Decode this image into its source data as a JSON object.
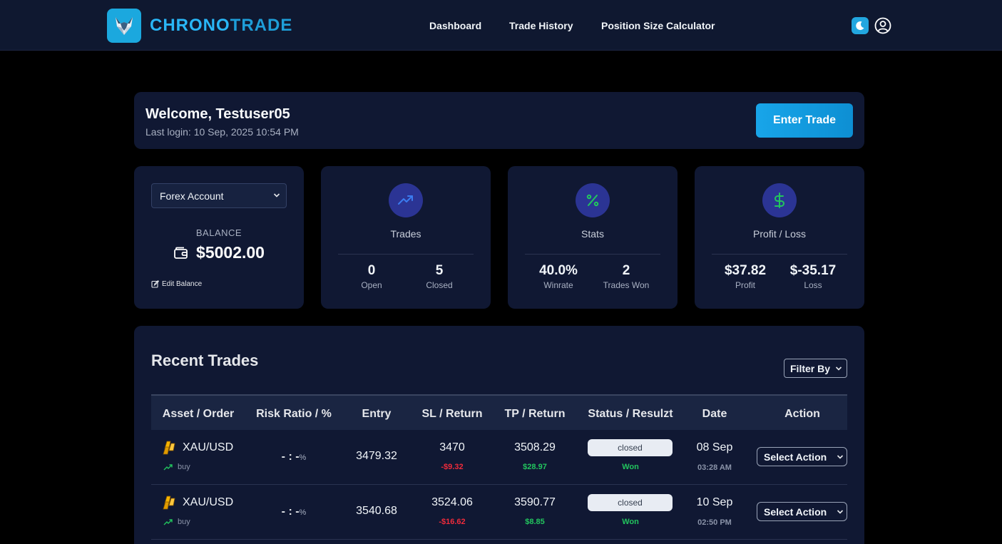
{
  "brand": {
    "part1": "CHRONO",
    "part2": "TRADE"
  },
  "nav": {
    "items": [
      "Dashboard",
      "Trade History",
      "Position Size Calculator"
    ]
  },
  "welcome": {
    "title": "Welcome, Testuser05",
    "last_login": "Last login: 10 Sep, 2025 10:54 PM",
    "enter_trade_label": "Enter Trade"
  },
  "account": {
    "selected": "Forex Account",
    "balance_label": "BALANCE",
    "balance_value": "$5002.00",
    "edit_label": "Edit Balance"
  },
  "trades_card": {
    "title": "Trades",
    "open_value": "0",
    "open_label": "Open",
    "closed_value": "5",
    "closed_label": "Closed"
  },
  "stats_card": {
    "title": "Stats",
    "winrate_value": "40.0%",
    "winrate_label": "Winrate",
    "won_value": "2",
    "won_label": "Trades Won"
  },
  "pl_card": {
    "title": "Profit / Loss",
    "profit_value": "$37.82",
    "profit_label": "Profit",
    "loss_value": "$-35.17",
    "loss_label": "Loss"
  },
  "recent": {
    "title": "Recent Trades",
    "filter_label": "Filter By",
    "columns": [
      "Asset / Order",
      "Risk Ratio / %",
      "Entry",
      "SL / Return",
      "TP / Return",
      "Status / Resulzt",
      "Date",
      "Action"
    ],
    "rows": [
      {
        "asset": "XAU/USD",
        "side": "buy",
        "risk": "- : -",
        "risk_unit": "%",
        "entry": "3479.32",
        "sl": "3470",
        "sl_return": "-$9.32",
        "tp": "3508.29",
        "tp_return": "$28.97",
        "status": "closed",
        "result": "Won",
        "date": "08 Sep",
        "time": "03:28 AM",
        "action": "Select Action"
      },
      {
        "asset": "XAU/USD",
        "side": "buy",
        "risk": "- : -",
        "risk_unit": "%",
        "entry": "3540.68",
        "sl": "3524.06",
        "sl_return": "-$16.62",
        "tp": "3590.77",
        "tp_return": "$8.85",
        "status": "closed",
        "result": "Won",
        "date": "10 Sep",
        "time": "02:50 PM",
        "action": "Select Action"
      }
    ]
  },
  "icons": {
    "logo": "fox-logo-icon",
    "theme": "moon-icon",
    "user": "user-circle-icon",
    "trades": "trending-up-icon",
    "stats": "percent-icon",
    "pl": "dollar-icon",
    "balance": "wallet-icon",
    "edit": "edit-icon",
    "asset": "gold-bars-icon",
    "side": "trending-up-icon"
  },
  "colors": {
    "accent": "#1ba8de",
    "background": "#000000",
    "card": "#101833",
    "topbar": "#0f1830",
    "negative": "#ef2b3b",
    "positive": "#22c55e",
    "icon_circle": "#2b3494"
  }
}
